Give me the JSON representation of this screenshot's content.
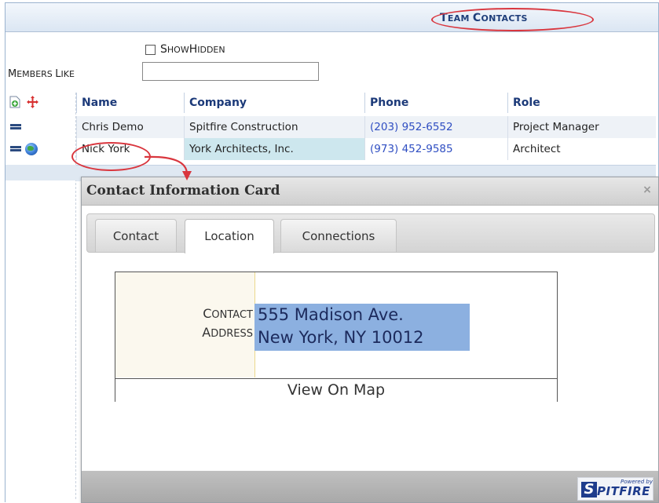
{
  "header": {
    "title_first": "T",
    "title_rest": "EAM ",
    "title_first2": "C",
    "title_rest2": "ONTACTS"
  },
  "filters": {
    "show_hidden_first": "S",
    "show_hidden_rest": "HOW ",
    "show_hidden_first2": "H",
    "show_hidden_rest2": "IDDEN",
    "members_first": "M",
    "members_rest": "EMBERS ",
    "members_first2": "L",
    "members_rest2": "IKE",
    "members_value": ""
  },
  "grid": {
    "columns": [
      "Name",
      "Company",
      "Phone",
      "Role"
    ],
    "rows": [
      {
        "name": "Chris Demo",
        "company": "Spitfire Construction",
        "phone": "(203) 952-6552",
        "role": "Project Manager"
      },
      {
        "name": "Nick York",
        "company": "York Architects, Inc.",
        "phone": "(973) 452-9585",
        "role": "Architect"
      }
    ]
  },
  "dialog": {
    "title": "Contact Information Card",
    "close": "×",
    "tabs": [
      "Contact",
      "Location",
      "Connections"
    ],
    "active_tab": "Location",
    "contact_label_first": "C",
    "contact_label_rest": "ONTACT",
    "address_label_first": "A",
    "address_label_rest": "DDRESS",
    "address_line1": "555 Madison Ave.",
    "address_line2": "New York, NY 10012",
    "map_button": "View On Map"
  },
  "footer": {
    "powered_by": "Powered by",
    "logo_s": "S",
    "logo_word": "PITFIRE"
  },
  "colors": {
    "accent": "#1f3e7a",
    "annotation": "#d9363e",
    "phone_link": "#2f4ec2",
    "address_highlight": "#8cb0e0"
  }
}
